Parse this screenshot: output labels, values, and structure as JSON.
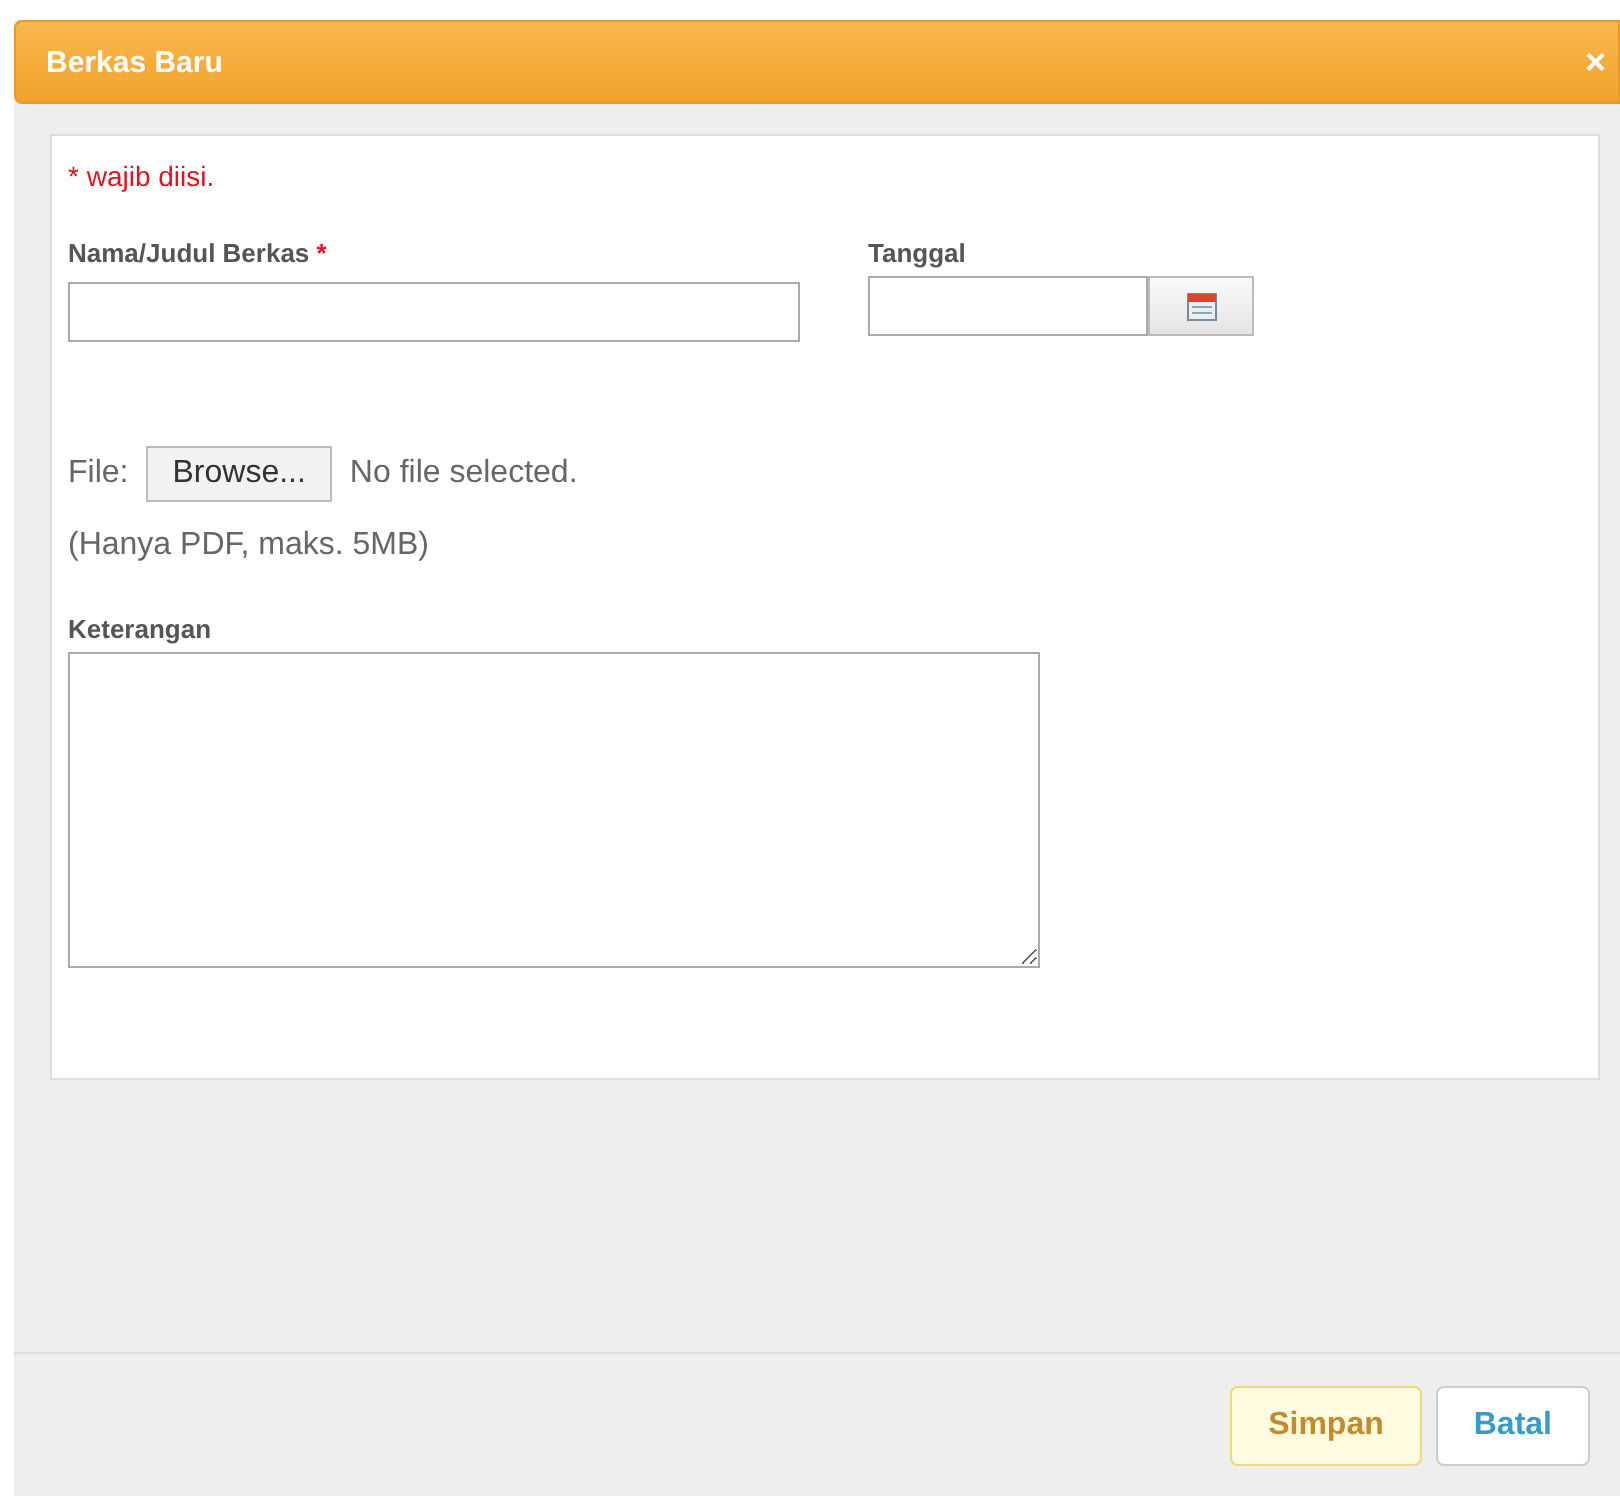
{
  "dialog": {
    "title": "Berkas Baru",
    "close": "×"
  },
  "form": {
    "required_note": "* wajib diisi.",
    "name_field": {
      "label": "Nama/Judul Berkas",
      "required_mark": "*"
    },
    "date_field": {
      "label": "Tanggal"
    },
    "file": {
      "label": "File:",
      "button": "Browse...",
      "status": "No file selected.",
      "hint": "(Hanya PDF, maks. 5MB)"
    },
    "notes_field": {
      "label": "Keterangan"
    }
  },
  "buttons": [
    {
      "label": "Simpan",
      "kind": "primary"
    },
    {
      "label": "Batal",
      "kind": "secondary"
    }
  ]
}
